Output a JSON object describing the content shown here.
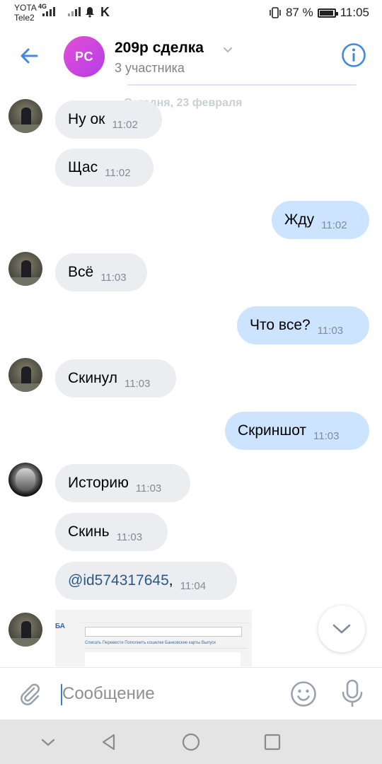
{
  "status_bar": {
    "carrier1": "YOTA",
    "carrier2": "Tele2",
    "net_type": "4G",
    "k_icon": "K",
    "battery_percent": "87 %",
    "battery_level": 0.87,
    "time": "11:05"
  },
  "header": {
    "avatar_initials": "PC",
    "title": "209р сделка",
    "subtitle": "3 участника"
  },
  "date_separator": "Сегодня, 23 февраля",
  "messages": [
    {
      "dir": "in",
      "text": "Ну ок",
      "time": "11:02"
    },
    {
      "dir": "in",
      "text": "Щас",
      "time": "11:02"
    },
    {
      "dir": "out",
      "text": "Жду",
      "time": "11:02"
    },
    {
      "dir": "in",
      "text": "Всё",
      "time": "11:03"
    },
    {
      "dir": "out",
      "text": "Что все?",
      "time": "11:03"
    },
    {
      "dir": "in",
      "text": "Скинул",
      "time": "11:03"
    },
    {
      "dir": "out",
      "text": "Скриншот",
      "time": "11:03"
    },
    {
      "dir": "in",
      "text": "Историю",
      "time": "11:03"
    },
    {
      "dir": "in",
      "text": "Скинь",
      "time": "11:03"
    },
    {
      "dir": "in",
      "link": "@id574317645",
      "text": ",",
      "time": "11:04"
    }
  ],
  "thumbnail": {
    "logo": "БА",
    "tabs": "Списать  Перевести  Пополнить кошелек  Банковские карты  Выпуск"
  },
  "composer": {
    "placeholder": "Сообщение"
  },
  "icons": {
    "back": "arrow-left-icon",
    "info": "info-icon",
    "attach": "paperclip-icon",
    "emoji": "smile-icon",
    "voice": "microphone-icon",
    "scroll": "chevron-down-icon"
  },
  "colors": {
    "accent": "#3f8ae0",
    "incoming_bubble": "#ebedf0",
    "outgoing_bubble": "#cce4ff"
  }
}
